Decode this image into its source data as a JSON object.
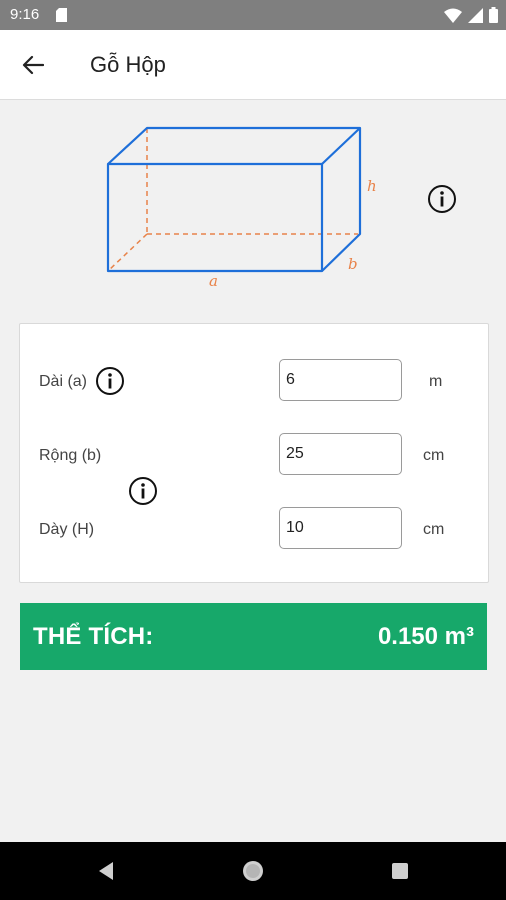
{
  "status_bar": {
    "time": "9:16"
  },
  "app_bar": {
    "title": "Gỗ Hộp"
  },
  "diagram": {
    "label_a": "a",
    "label_b": "b",
    "label_h": "h"
  },
  "form": {
    "length": {
      "label": "Dài (a)",
      "value": "6",
      "unit": "m"
    },
    "width": {
      "label": "Rộng (b)",
      "value": "25",
      "unit": "cm"
    },
    "thickness": {
      "label": "Dày (H)",
      "value": "10",
      "unit": "cm"
    }
  },
  "result": {
    "label": "THỂ TÍCH:",
    "value": "0.150 m³"
  },
  "colors": {
    "accent_green": "#17a86a",
    "box_blue": "#1e6fd9",
    "dim_orange": "#e8834a"
  }
}
